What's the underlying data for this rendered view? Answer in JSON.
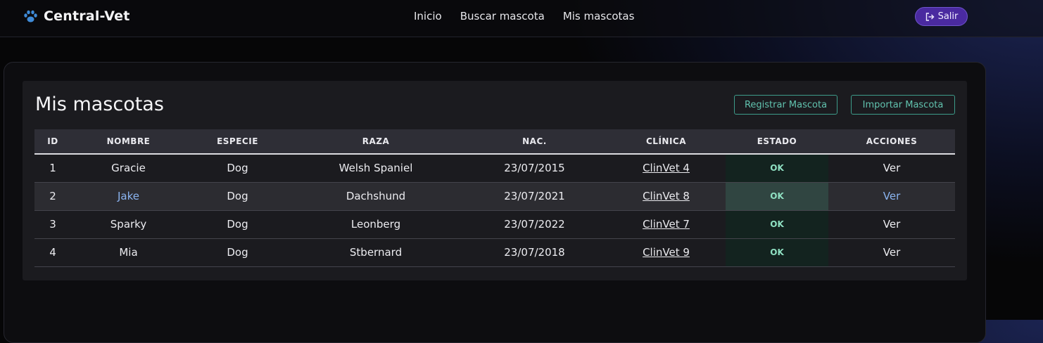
{
  "brand": {
    "name": "Central-Vet",
    "icon": "paw-icon"
  },
  "nav": {
    "links": [
      "Inicio",
      "Buscar mascota",
      "Mis mascotas"
    ]
  },
  "logout": {
    "label": "Salir",
    "icon": "logout-icon"
  },
  "page": {
    "title": "Mis mascotas"
  },
  "actions": {
    "register_label": "Registrar Mascota",
    "import_label": "Importar Mascota"
  },
  "table": {
    "headers": [
      "ID",
      "NOMBRE",
      "ESPECIE",
      "RAZA",
      "NAC.",
      "CLÍNICA",
      "ESTADO",
      "ACCIONES"
    ],
    "rows": [
      {
        "id": "1",
        "name": "Gracie",
        "species": "Dog",
        "breed": "Welsh Spaniel",
        "birth": "23/07/2015",
        "clinic": "ClinVet 4",
        "status": "OK",
        "action": "Ver"
      },
      {
        "id": "2",
        "name": "Jake",
        "species": "Dog",
        "breed": "Dachshund",
        "birth": "23/07/2021",
        "clinic": "ClinVet 8",
        "status": "OK",
        "action": "Ver"
      },
      {
        "id": "3",
        "name": "Sparky",
        "species": "Dog",
        "breed": "Leonberg",
        "birth": "23/07/2022",
        "clinic": "ClinVet 7",
        "status": "OK",
        "action": "Ver"
      },
      {
        "id": "4",
        "name": "Mia",
        "species": "Dog",
        "breed": "Stbernard",
        "birth": "23/07/2018",
        "clinic": "ClinVet 9",
        "status": "OK",
        "action": "Ver"
      }
    ]
  },
  "colors": {
    "accent": "#4a2aa0",
    "outline": "#3d9c8a",
    "status": "#8fe0c2",
    "link_hover": "#8ab4f0"
  }
}
